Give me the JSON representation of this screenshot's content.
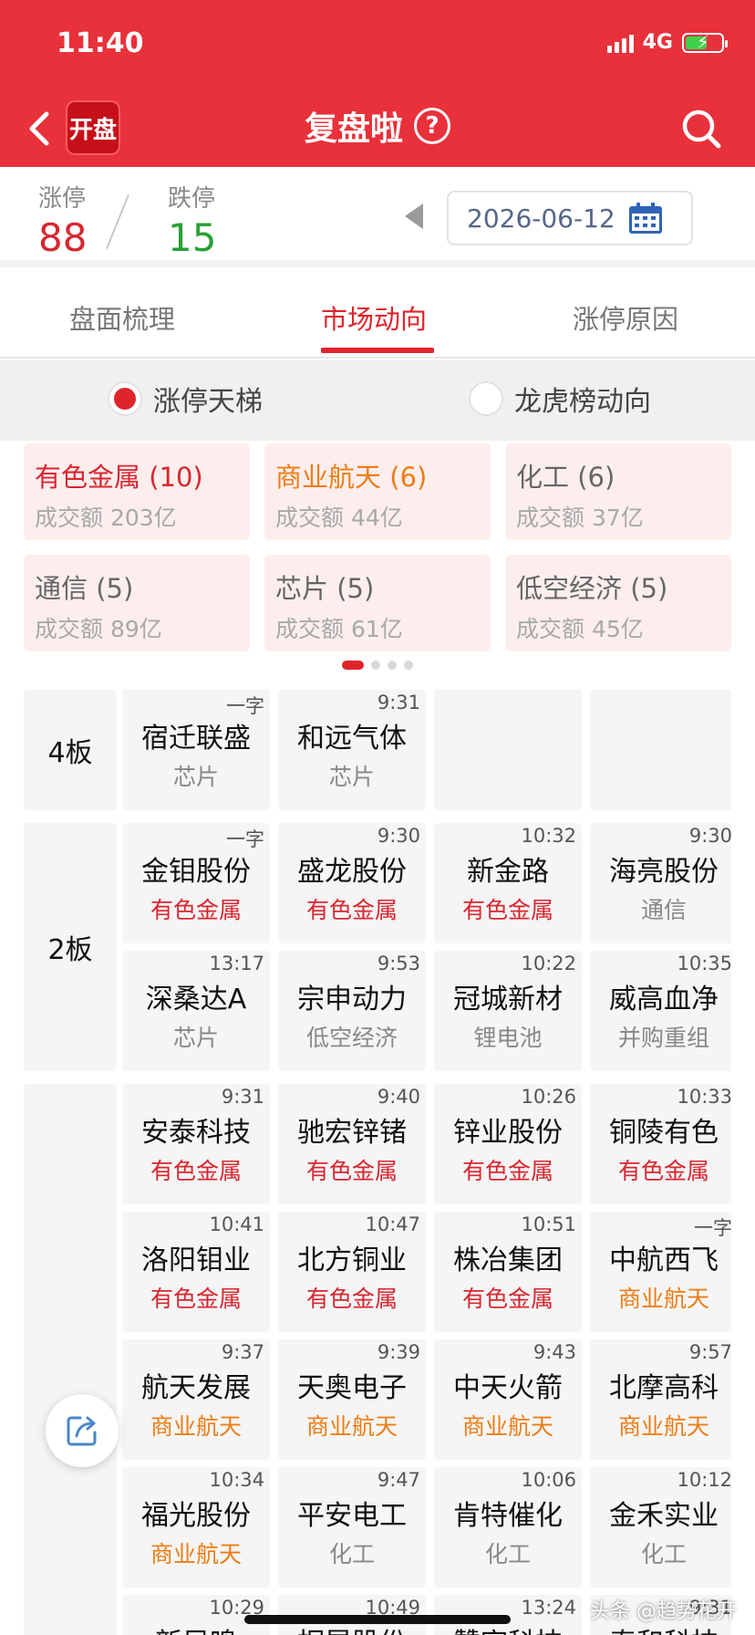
{
  "status_bar": {
    "time": "11:40",
    "network": "4G"
  },
  "header": {
    "logo_text": "开盘",
    "title": "复盘啦",
    "help_symbol": "?"
  },
  "stats": {
    "limit_up_label": "涨停",
    "limit_up_count": "88",
    "limit_down_label": "跌停",
    "limit_down_count": "15",
    "date": "2026-06-12"
  },
  "tabs": [
    {
      "label": "盘面梳理"
    },
    {
      "label": "市场动向",
      "active": true
    },
    {
      "label": "涨停原因"
    }
  ],
  "radios": [
    {
      "label": "涨停天梯",
      "checked": true
    },
    {
      "label": "龙虎榜动向",
      "checked": false
    }
  ],
  "sector_cards": [
    {
      "name": "有色金属 (10)",
      "amount": "成交额 203亿",
      "tone": "red"
    },
    {
      "name": "商业航天 (6)",
      "amount": "成交额 44亿",
      "tone": "orange"
    },
    {
      "name": "化工 (6)",
      "amount": "成交额 37亿",
      "tone": "gray"
    },
    {
      "name": "通信 (5)",
      "amount": "成交额 89亿",
      "tone": "gray"
    },
    {
      "name": "芯片 (5)",
      "amount": "成交额 61亿",
      "tone": "gray"
    },
    {
      "name": "低空经济 (5)",
      "amount": "成交额 45亿",
      "tone": "gray"
    }
  ],
  "pager": {
    "count": 4,
    "active_index": 0
  },
  "ladder": {
    "tiers": [
      {
        "label": "4板",
        "rows": 1
      },
      {
        "label": "2板",
        "rows": 2
      },
      {
        "label": "",
        "rows": 5
      }
    ],
    "rows": [
      [
        {
          "time": "一字",
          "name": "宿迁联盛",
          "sector": "芯片",
          "tone": "gray"
        },
        {
          "time": "9:31",
          "name": "和远气体",
          "sector": "芯片",
          "tone": "gray"
        },
        null,
        null
      ],
      [
        {
          "time": "一字",
          "name": "金钼股份",
          "sector": "有色金属",
          "tone": "red"
        },
        {
          "time": "9:30",
          "name": "盛龙股份",
          "sector": "有色金属",
          "tone": "red"
        },
        {
          "time": "10:32",
          "name": "新金路",
          "sector": "有色金属",
          "tone": "red"
        },
        {
          "time": "9:30",
          "name": "海亮股份",
          "sector": "通信",
          "tone": "gray"
        }
      ],
      [
        {
          "time": "13:17",
          "name": "深桑达A",
          "sector": "芯片",
          "tone": "gray"
        },
        {
          "time": "9:53",
          "name": "宗申动力",
          "sector": "低空经济",
          "tone": "gray"
        },
        {
          "time": "10:22",
          "name": "冠城新材",
          "sector": "锂电池",
          "tone": "gray"
        },
        {
          "time": "10:35",
          "name": "威高血净",
          "sector": "并购重组",
          "tone": "gray"
        }
      ],
      [
        {
          "time": "9:31",
          "name": "安泰科技",
          "sector": "有色金属",
          "tone": "red"
        },
        {
          "time": "9:40",
          "name": "驰宏锌锗",
          "sector": "有色金属",
          "tone": "red"
        },
        {
          "time": "10:26",
          "name": "锌业股份",
          "sector": "有色金属",
          "tone": "red"
        },
        {
          "time": "10:33",
          "name": "铜陵有色",
          "sector": "有色金属",
          "tone": "red"
        }
      ],
      [
        {
          "time": "10:41",
          "name": "洛阳钼业",
          "sector": "有色金属",
          "tone": "red"
        },
        {
          "time": "10:47",
          "name": "北方铜业",
          "sector": "有色金属",
          "tone": "red"
        },
        {
          "time": "10:51",
          "name": "株冶集团",
          "sector": "有色金属",
          "tone": "red"
        },
        {
          "time": "一字",
          "name": "中航西飞",
          "sector": "商业航天",
          "tone": "orange"
        }
      ],
      [
        {
          "time": "9:37",
          "name": "航天发展",
          "sector": "商业航天",
          "tone": "orange"
        },
        {
          "time": "9:39",
          "name": "天奥电子",
          "sector": "商业航天",
          "tone": "orange"
        },
        {
          "time": "9:43",
          "name": "中天火箭",
          "sector": "商业航天",
          "tone": "orange"
        },
        {
          "time": "9:57",
          "name": "北摩高科",
          "sector": "商业航天",
          "tone": "orange"
        }
      ],
      [
        {
          "time": "10:34",
          "name": "福光股份",
          "sector": "商业航天",
          "tone": "orange"
        },
        {
          "time": "9:47",
          "name": "平安电工",
          "sector": "化工",
          "tone": "gray"
        },
        {
          "time": "10:06",
          "name": "肯特催化",
          "sector": "化工",
          "tone": "gray"
        },
        {
          "time": "10:12",
          "name": "金禾实业",
          "sector": "化工",
          "tone": "gray"
        }
      ],
      [
        {
          "time": "10:29",
          "name": "新凤鸣",
          "sector": "",
          "tone": "gray"
        },
        {
          "time": "10:49",
          "name": "桐昆股份",
          "sector": "",
          "tone": "gray"
        },
        {
          "time": "13:24",
          "name": "赞宇科技",
          "sector": "",
          "tone": "gray"
        },
        {
          "time": "9:31",
          "name": "泰和科技",
          "sector": "",
          "tone": "gray"
        }
      ]
    ]
  },
  "watermark": "头条 @趋势花开"
}
